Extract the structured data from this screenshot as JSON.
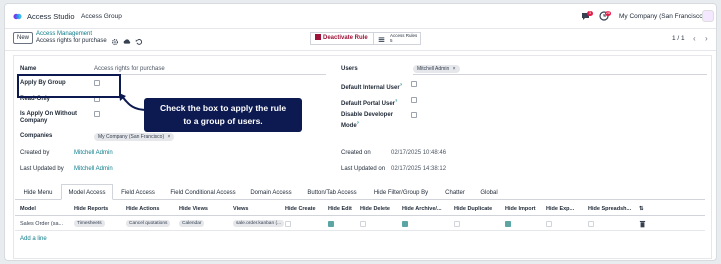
{
  "topbar": {
    "app_title": "Access Studio",
    "menu_item": "Access Group",
    "chat_badge": "3",
    "activity_badge": "28",
    "company": "My Company (San Francisco)"
  },
  "control": {
    "new_label": "New",
    "breadcrumb_parent": "Access Management",
    "breadcrumb_current": "Access rights for purchase",
    "deactivate_label": "Deactivate Rule",
    "access_rules_label": "Access Rules",
    "access_rules_count": "5",
    "pager": "1 / 1"
  },
  "form": {
    "name_label": "Name",
    "name_value": "Access rights for purchase",
    "apply_by_group_label": "Apply By Group",
    "read_only_label": "Read-Only",
    "apply_without_company_label": "Is Apply On Without Company",
    "companies_label": "Companies",
    "companies_tag": "My Company (San Francisco)",
    "created_by_label": "Created by",
    "created_by_value": "Mitchell Admin",
    "last_updated_by_label": "Last Updated by",
    "last_updated_by_value": "Mitchell Admin",
    "users_label": "Users",
    "users_tag": "Mitchell Admin",
    "default_internal_label": "Default Internal User",
    "default_portal_label": "Default Portal User",
    "disable_dev_label": "Disable Developer Mode",
    "created_on_label": "Created on",
    "created_on_value": "02/17/2025 10:48:46",
    "last_updated_on_label": "Last Updated on",
    "last_updated_on_value": "02/17/2025 14:38:12",
    "help_mark": "?"
  },
  "callout": {
    "line1": "Check the box to apply the rule",
    "line2": "to a group of users."
  },
  "tabs": [
    "Hide Menu",
    "Model Access",
    "Field Access",
    "Field Conditional Access",
    "Domain Access",
    "Button/Tab Access",
    "Hide Filter/Group By",
    "Chatter",
    "Global"
  ],
  "table": {
    "headers": [
      "Model",
      "Hide Reports",
      "Hide Actions",
      "Hide Views",
      "Views",
      "Hide Create",
      "Hide Edit",
      "Hide Delete",
      "Hide Archive/...",
      "Hide Duplicate",
      "Hide Import",
      "Hide Exp...",
      "Hide Spreadsh..."
    ],
    "row": {
      "model": "Sales Order (sa...",
      "reports_tag": "Timesheets",
      "actions_tag": "Cancel quotations",
      "views_tag": "Calendar",
      "views_tag2": "sale.order.kanban (..."
    },
    "add_line": "Add a line"
  },
  "colors": {
    "accent": "#0d7c8a",
    "callout_bg": "#0d1a52",
    "checkbox_checked": "#5ba5a5",
    "deactivate_text": "#9f1239"
  }
}
